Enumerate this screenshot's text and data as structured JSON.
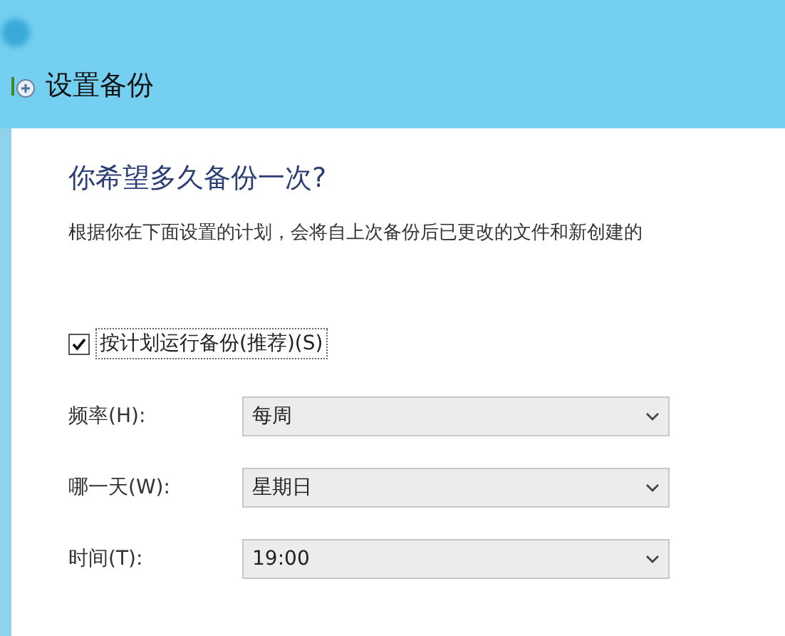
{
  "window": {
    "title": "设置备份"
  },
  "heading": "你希望多久备份一次?",
  "description": "根据你在下面设置的计划，会将自上次备份后已更改的文件和新创建的",
  "schedule_checkbox": {
    "label": "按计划运行备份(推荐)(S)",
    "checked": true,
    "focused": true
  },
  "fields": [
    {
      "label": "频率(H):",
      "value": "每周"
    },
    {
      "label": "哪一天(W):",
      "value": "星期日"
    },
    {
      "label": "时间(T):",
      "value": "19:00"
    }
  ]
}
